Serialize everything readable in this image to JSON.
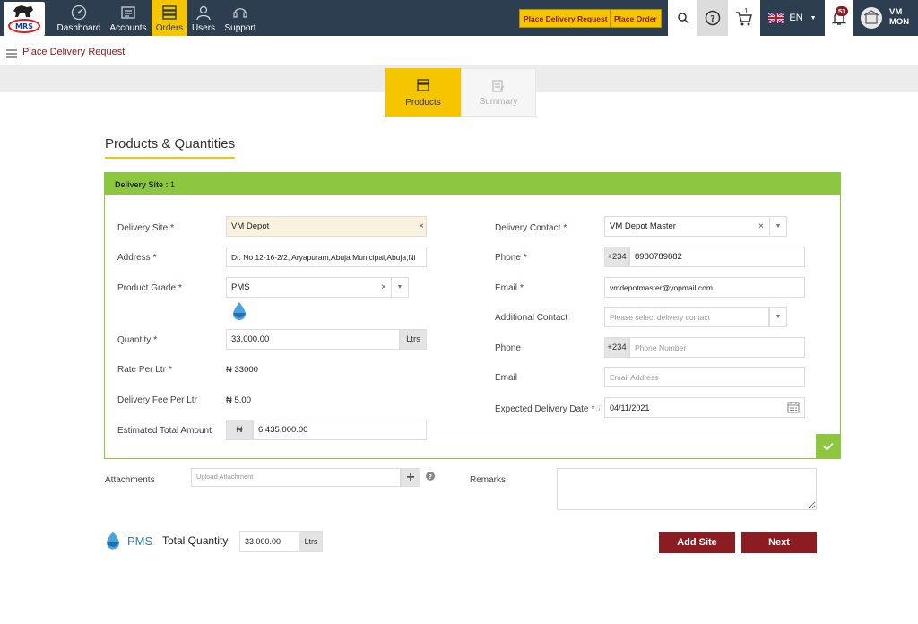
{
  "nav": {
    "logo_text": "MRS",
    "items": [
      {
        "label": "Dashboard"
      },
      {
        "label": "Accounts"
      },
      {
        "label": "Orders"
      },
      {
        "label": "Users"
      },
      {
        "label": "Support"
      }
    ],
    "place_delivery_label": "Place Delivery Request",
    "place_order_label": "Place Order",
    "language": "EN",
    "notification_count": "53",
    "user_initials": "VM",
    "user_name": "MON",
    "cart_count": "1"
  },
  "breadcrumb": {
    "label": "Place Delivery Request"
  },
  "steps": [
    {
      "label": "Products",
      "active": true
    },
    {
      "label": "Summary",
      "active": false
    }
  ],
  "section_title": "Products & Quantities",
  "site": {
    "header_label": "Delivery Site :",
    "header_index": "1",
    "left": {
      "delivery_site_label": "Delivery Site",
      "delivery_site_value": "VM Depot",
      "address_label": "Address",
      "address_value": "Dr. No 12-16-2/2, Aryapuram,Abuja Municipal,Abuja,Ni",
      "product_grade_label": "Product Grade",
      "product_grade_value": "PMS",
      "quantity_label": "Quantity",
      "quantity_value": "33,000.00",
      "quantity_unit": "Ltrs",
      "rate_label": "Rate Per Ltr",
      "rate_value": "₦ 33000",
      "fee_label": "Delivery Fee Per Ltr",
      "fee_value": "₦ 5.00",
      "total_label": "Estimated Total Amount",
      "currency_symbol": "₦",
      "total_value": "6,435,000.00"
    },
    "right": {
      "contact_label": "Delivery Contact",
      "contact_value": "VM Depot Master",
      "phone_label": "Phone",
      "phone_code": "+234",
      "phone_value": "8980789882",
      "email_label": "Email",
      "email_value": "vmdepotmaster@yopmail.com",
      "additional_contact_label": "Additional Contact",
      "additional_contact_placeholder": "Please select delivery contact",
      "phone2_label": "Phone",
      "phone2_code": "+234",
      "phone2_placeholder": "Phone Number",
      "email2_label": "Email",
      "email2_placeholder": "Email Address",
      "date_label": "Expected Delivery Date",
      "date_value": "04/11/2021"
    }
  },
  "attachments": {
    "label": "Attachments",
    "placeholder": "Upload Attachment",
    "remarks_label": "Remarks"
  },
  "footer": {
    "product_name": "PMS",
    "total_quantity_label": "Total Quantity",
    "total_quantity_value": "33,000.00",
    "unit": "Ltrs",
    "add_site_label": "Add Site",
    "next_label": "Next"
  },
  "colors": {
    "navbar": "#2d3e50",
    "accent_yellow": "#f5c500",
    "brand_maroon": "#8a1c22",
    "site_green": "#8dc63f"
  }
}
